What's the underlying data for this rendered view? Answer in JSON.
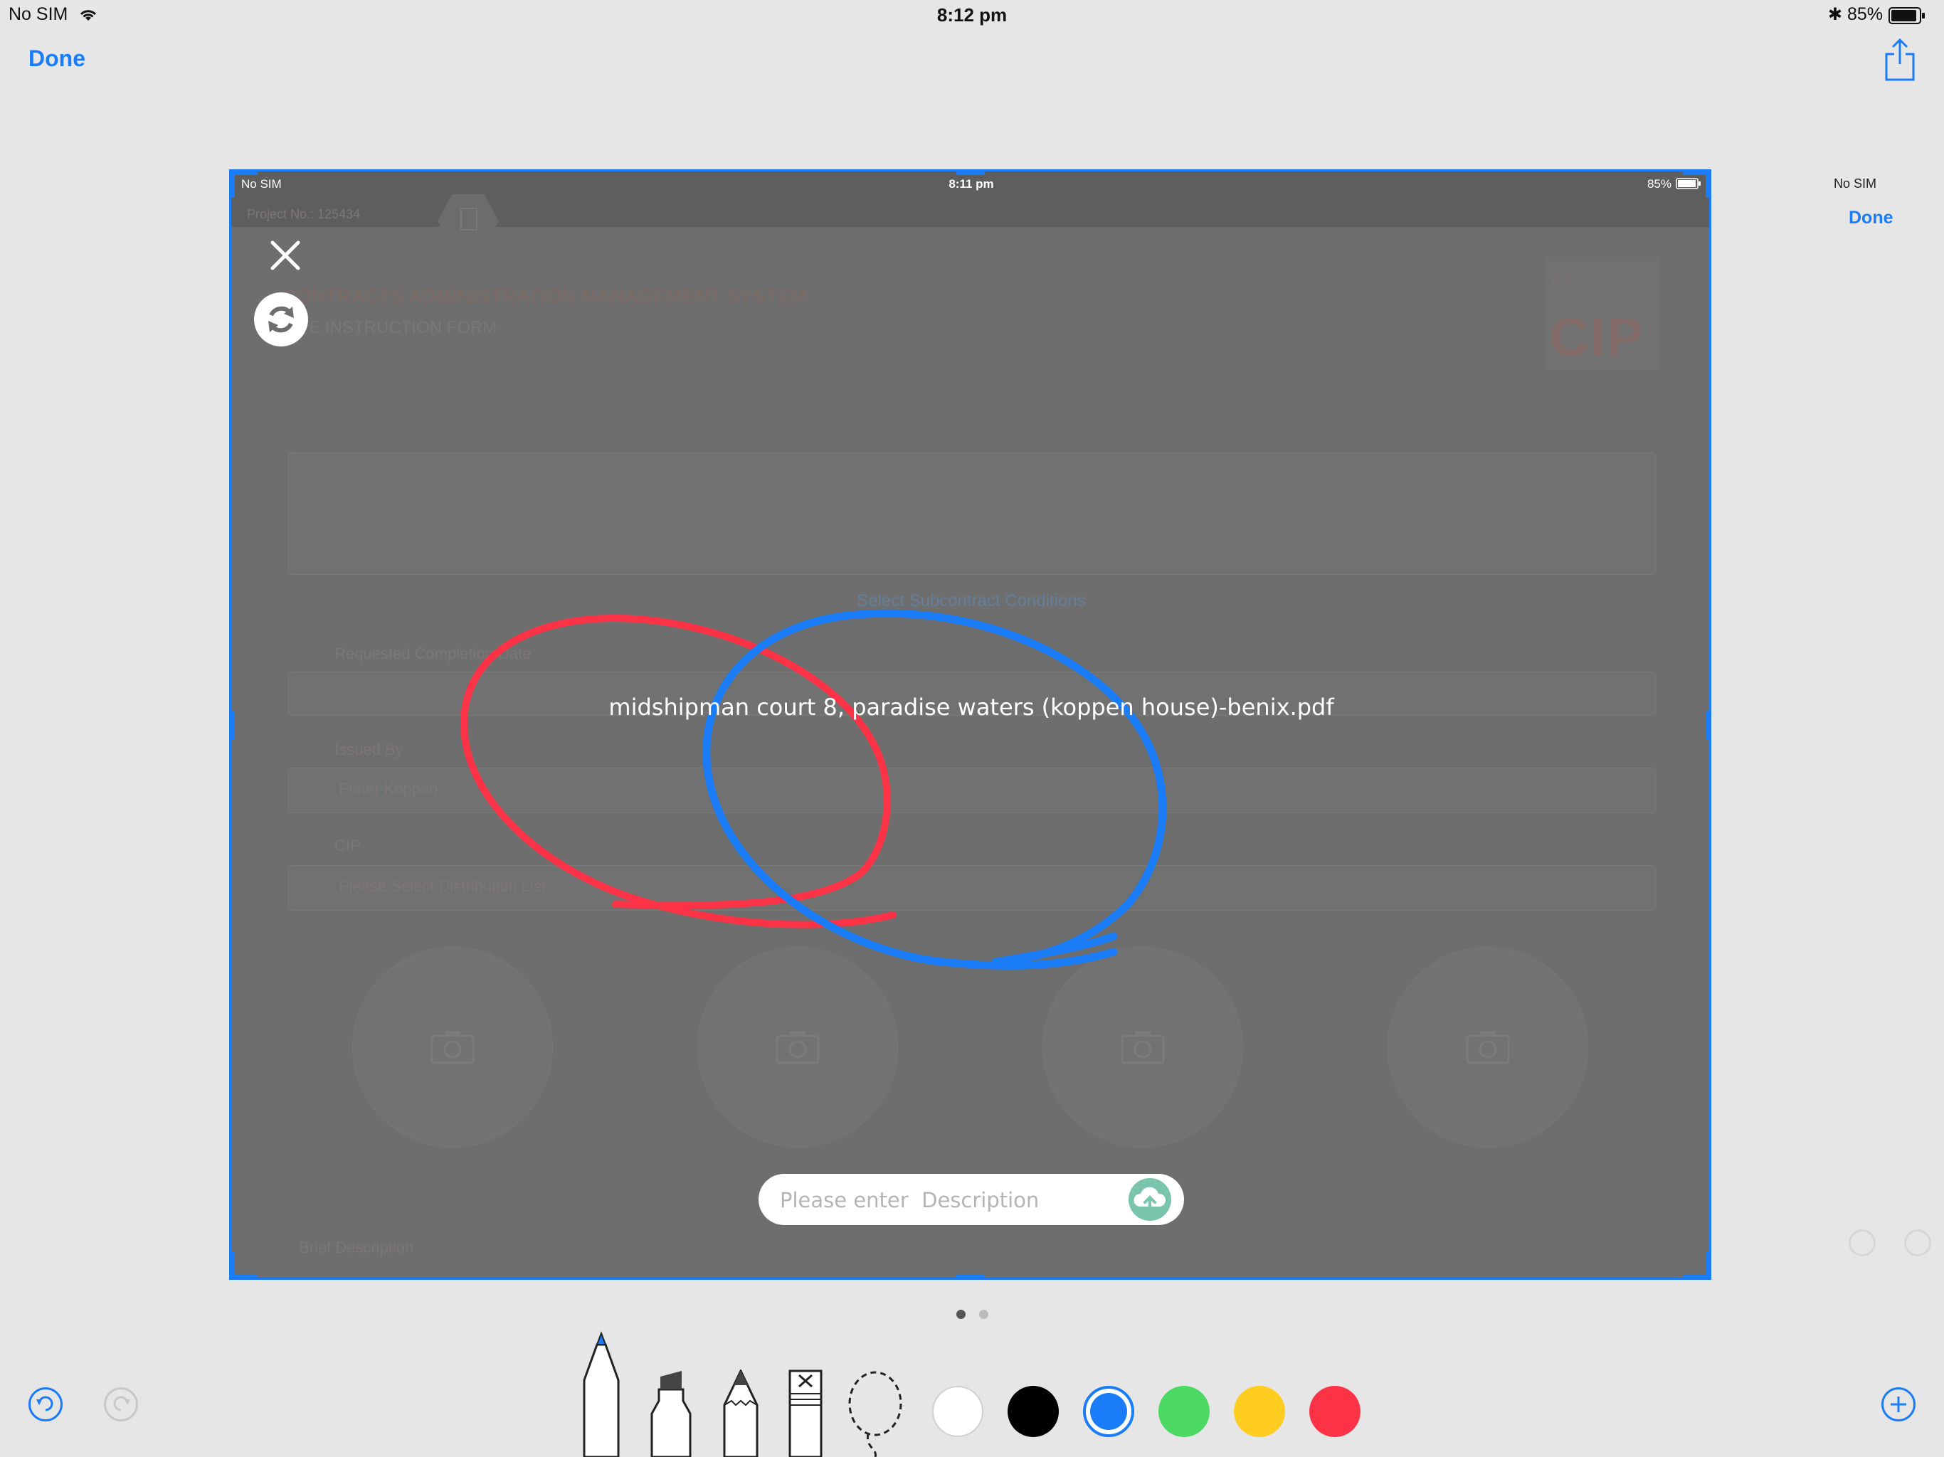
{
  "status_bar": {
    "carrier": "No SIM",
    "time": "8:12 pm",
    "battery": "85%"
  },
  "toolbar": {
    "done_label": "Done"
  },
  "screenshot": {
    "status_bar": {
      "carrier": "No SIM",
      "time": "8:11 pm",
      "battery": "85%"
    },
    "file_title": "midshipman court 8, paradise waters (koppen house)-benix.pdf",
    "description": {
      "placeholder": "Please enter  Description",
      "value": ""
    },
    "background_form": {
      "project_no": "Project No.: 125434",
      "system_title": "CONTRACTS ADMINISTRATION MANAGEMENT SYSTEM",
      "form_title": "SITE INSTRUCTION FORM",
      "subcontract_link": "Select Subcontract Conditions",
      "requested_completion_label": "Requested Completion Date",
      "issued_by_label": "Issued By",
      "issued_by_value": "Pieter Koppen",
      "cc_label": "CIP",
      "distribution_value": "Please Select Distribution List",
      "brief_description_label": "Brief Description",
      "logo_text": "CIP",
      "logo_caption": [
        "CONSTRUCTION",
        "DEVELOPMENT",
        "BUILDING",
        "DESIGN"
      ]
    }
  },
  "side_panel": {
    "carrier": "No SIM",
    "done_label": "Done"
  },
  "pagination": {
    "current_page": 1,
    "total_pages": 2
  },
  "markup_tools": {
    "tools": [
      "pen-icon",
      "marker-icon",
      "pencil-icon",
      "eraser-icon",
      "lasso-icon"
    ],
    "colors": [
      "#ffffff",
      "#000000",
      "#1a7cf6",
      "#4cd964",
      "#ffcc22",
      "#fc3346"
    ],
    "selected_color": "#1a7cf6",
    "selected_tool": "pen-icon"
  },
  "annotations": [
    {
      "tool": "pen",
      "color": "#fc3346"
    },
    {
      "tool": "pen",
      "color": "#1a7cf6"
    }
  ]
}
